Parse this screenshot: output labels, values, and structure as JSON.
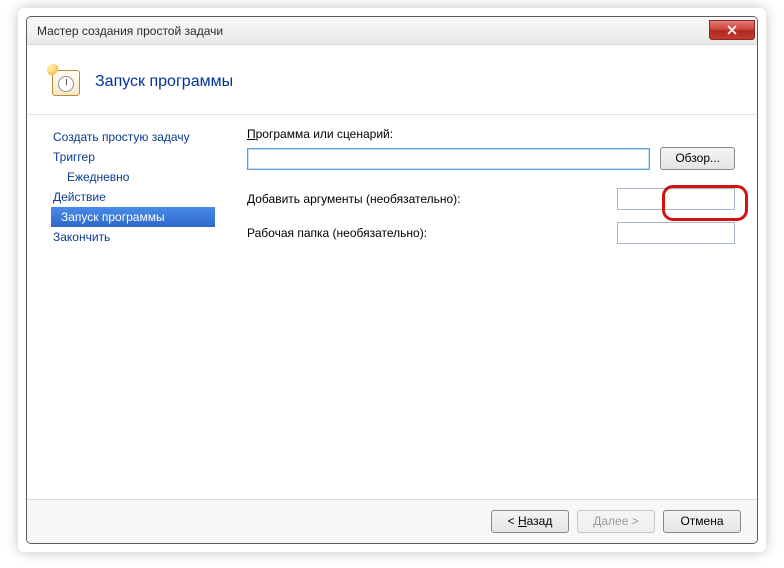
{
  "window": {
    "title": "Мастер создания простой задачи"
  },
  "header": {
    "title": "Запуск программы"
  },
  "sidebar": {
    "items": [
      {
        "label": "Создать простую задачу",
        "indent": false,
        "active": false
      },
      {
        "label": "Триггер",
        "indent": false,
        "active": false
      },
      {
        "label": "Ежедневно",
        "indent": true,
        "active": false
      },
      {
        "label": "Действие",
        "indent": false,
        "active": false
      },
      {
        "label": "Запуск программы",
        "indent": true,
        "active": true
      },
      {
        "label": "Закончить",
        "indent": false,
        "active": false
      }
    ]
  },
  "content": {
    "program_label_pre": "П",
    "program_label_rest": "рограмма или сценарий:",
    "program_value": "",
    "browse_label": "Обзор...",
    "browse_accel": "О",
    "args_label_pre": "Добавить ",
    "args_label_ul": "а",
    "args_label_rest": "ргументы (необязательно):",
    "args_value": "",
    "workdir_label_pre": "Рабо",
    "workdir_label_ul": "ч",
    "workdir_label_rest": "ая папка (необязательно):",
    "workdir_value": ""
  },
  "footer": {
    "back_pre": "< ",
    "back_ul": "Н",
    "back_rest": "азад",
    "next_pre": "",
    "next_ul": "Д",
    "next_rest": "алее >",
    "cancel": "Отмена"
  }
}
